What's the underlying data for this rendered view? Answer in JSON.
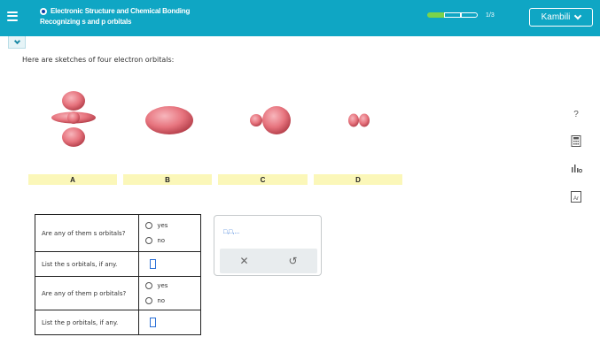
{
  "header": {
    "topic": "Electronic Structure and Chemical Bonding",
    "subtopic": "Recognizing s and p orbitals",
    "progress": {
      "completed": 1,
      "total": 3,
      "text": "1/3"
    },
    "language_button": "Kambili"
  },
  "intro": "Here are sketches of four electron orbitals:",
  "orbitals": [
    {
      "label": "A",
      "kind": "d-shaped lobes"
    },
    {
      "label": "B",
      "kind": "ellipsoid"
    },
    {
      "label": "C",
      "kind": "two unequal spheres"
    },
    {
      "label": "D",
      "kind": "two small lobes"
    }
  ],
  "questions": [
    {
      "question": "Are any of them s orbitals?",
      "type": "radio",
      "options": [
        "yes",
        "no"
      ]
    },
    {
      "question": "List the s orbitals, if any.",
      "type": "input",
      "value": ""
    },
    {
      "question": "Are any of them p orbitals?",
      "type": "radio",
      "options": [
        "yes",
        "no"
      ]
    },
    {
      "question": "List the p orbitals, if any.",
      "type": "input",
      "value": ""
    }
  ],
  "palette": {
    "symbol_text": "□,□,..."
  },
  "icons": {
    "menu": "menu-icon",
    "help": "question-icon",
    "calculator": "calculator-icon",
    "chart": "chart-icon",
    "periodic": "periodic-table-icon"
  },
  "colors": {
    "header": "#0fa6c4",
    "progress": "#7bd34b",
    "label_bg": "#fbf7b9",
    "orbital": "#e7747e"
  }
}
